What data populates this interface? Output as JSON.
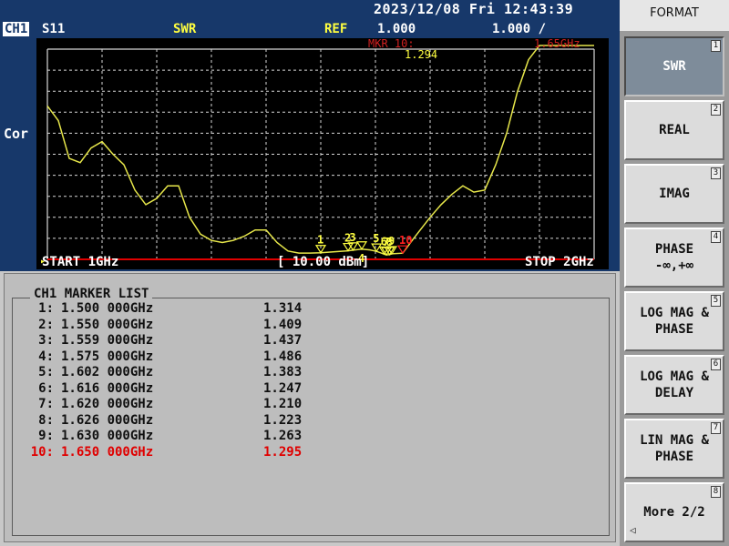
{
  "header": {
    "datetime": "2023/12/08 Fri 12:43:39"
  },
  "params": {
    "channel": "CH1",
    "measurement": "S11",
    "format": "SWR",
    "ref_label": "REF",
    "ref_value": "1.000",
    "scale_value": "1.000 /",
    "marker_readout_label": "MKR 10:",
    "marker_readout_value": "1.294",
    "marker_readout_freq": "1.65GHz",
    "cor": "Cor",
    "start": "START 1GHz",
    "power": "[ 10.00 dBm]",
    "stop": "STOP 2GHz"
  },
  "marker_list": {
    "title": "CH1 MARKER LIST",
    "rows": [
      {
        "idx": "1:",
        "freq": "1.500 000GHz",
        "value": "1.314"
      },
      {
        "idx": "2:",
        "freq": "1.550 000GHz",
        "value": "1.409"
      },
      {
        "idx": "3:",
        "freq": "1.559 000GHz",
        "value": "1.437"
      },
      {
        "idx": "4:",
        "freq": "1.575 000GHz",
        "value": "1.486"
      },
      {
        "idx": "5:",
        "freq": "1.602 000GHz",
        "value": "1.383"
      },
      {
        "idx": "6:",
        "freq": "1.616 000GHz",
        "value": "1.247"
      },
      {
        "idx": "7:",
        "freq": "1.620 000GHz",
        "value": "1.210"
      },
      {
        "idx": "8:",
        "freq": "1.626 000GHz",
        "value": "1.223"
      },
      {
        "idx": "9:",
        "freq": "1.630 000GHz",
        "value": "1.263"
      },
      {
        "idx": "10:",
        "freq": "1.650 000GHz",
        "value": "1.295",
        "active": true
      }
    ]
  },
  "softkeys": {
    "title": "FORMAT",
    "items": [
      {
        "label": "SWR",
        "num": "1",
        "selected": true
      },
      {
        "label": "REAL",
        "num": "2"
      },
      {
        "label": "IMAG",
        "num": "3"
      },
      {
        "label": "PHASE\n-∞,+∞",
        "num": "4"
      },
      {
        "label": "LOG MAG &\nPHASE",
        "num": "5"
      },
      {
        "label": "LOG MAG &\nDELAY",
        "num": "6"
      },
      {
        "label": "LIN MAG &\nPHASE",
        "num": "7"
      },
      {
        "label": "More 2/2",
        "num": "8"
      }
    ]
  },
  "colors": {
    "background": "#17386a",
    "trace": "#e6e64a",
    "grid": "#d8d8d8",
    "reference_line": "#e00000",
    "active_marker": "#ff2020"
  },
  "chart_data": {
    "type": "line",
    "xlabel": "",
    "ylabel": "",
    "xlim": [
      1.0,
      2.0
    ],
    "ylim": [
      1.0,
      11.0
    ],
    "grid": true,
    "series": [
      {
        "x": [
          1.0,
          1.02,
          1.04,
          1.06,
          1.08,
          1.1,
          1.12,
          1.14,
          1.16,
          1.18,
          1.2,
          1.22,
          1.24,
          1.26,
          1.28,
          1.3,
          1.32,
          1.34,
          1.36,
          1.38,
          1.4,
          1.42,
          1.44,
          1.46,
          1.48,
          1.5,
          1.52,
          1.55,
          1.559,
          1.575,
          1.59,
          1.602,
          1.616,
          1.62,
          1.626,
          1.63,
          1.65,
          1.67,
          1.7,
          1.72,
          1.74,
          1.76,
          1.78,
          1.8,
          1.82,
          1.84,
          1.86,
          1.88,
          1.9,
          1.92,
          1.94,
          1.96,
          1.98,
          2.0
        ],
        "y": [
          8.3,
          7.6,
          5.8,
          5.6,
          6.3,
          6.6,
          6.0,
          5.5,
          4.3,
          3.6,
          3.9,
          4.5,
          4.5,
          3.0,
          2.2,
          1.9,
          1.8,
          1.9,
          2.1,
          2.4,
          2.4,
          1.8,
          1.4,
          1.3,
          1.3,
          1.314,
          1.35,
          1.409,
          1.437,
          1.486,
          1.45,
          1.383,
          1.247,
          1.21,
          1.223,
          1.263,
          1.295,
          2.0,
          3.0,
          3.6,
          4.1,
          4.5,
          4.2,
          4.3,
          5.5,
          7.0,
          9.0,
          10.5,
          12.0,
          13.5,
          14.7,
          15.6,
          16.0,
          16.5
        ]
      }
    ],
    "markers": [
      {
        "label": "1",
        "x": 1.5,
        "y": 1.314
      },
      {
        "label": "2",
        "x": 1.55,
        "y": 1.409
      },
      {
        "label": "3",
        "x": 1.559,
        "y": 1.437
      },
      {
        "label": "4",
        "x": 1.575,
        "y": 1.486
      },
      {
        "label": "5",
        "x": 1.602,
        "y": 1.383
      },
      {
        "label": "6",
        "x": 1.616,
        "y": 1.247
      },
      {
        "label": "7",
        "x": 1.62,
        "y": 1.21
      },
      {
        "label": "8",
        "x": 1.626,
        "y": 1.223
      },
      {
        "label": "9",
        "x": 1.63,
        "y": 1.263
      },
      {
        "label": "10",
        "x": 1.65,
        "y": 1.295,
        "active": true
      }
    ]
  }
}
